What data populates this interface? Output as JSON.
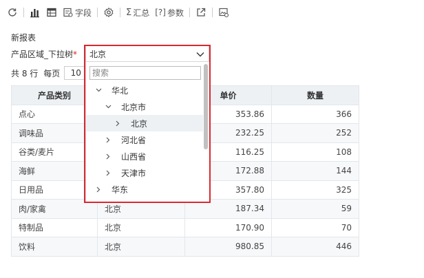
{
  "toolbar": {
    "items": [
      {
        "icon": "refresh-icon"
      },
      {
        "icon": "chart-icon"
      },
      {
        "icon": "table-icon"
      },
      {
        "icon": "field-icon",
        "label": "字段"
      },
      {
        "icon": "settings-icon"
      },
      {
        "icon": "sum-icon",
        "label": "汇总"
      },
      {
        "icon": "param-icon",
        "label": "参数"
      },
      {
        "icon": "export-icon"
      },
      {
        "icon": "image-settings-icon"
      }
    ],
    "param_prefix": "[?]"
  },
  "report": {
    "title": "新报表"
  },
  "param": {
    "label": "产品区域_下拉树",
    "required_mark": "*",
    "value": "北京"
  },
  "pager": {
    "total": "共 8 行",
    "per_page_label": "每页",
    "page_size": "10"
  },
  "dropdown": {
    "search_placeholder": "搜索",
    "nodes": [
      {
        "label": "华北",
        "expanded": true,
        "level": 0
      },
      {
        "label": "北京市",
        "expanded": true,
        "level": 1
      },
      {
        "label": "北京",
        "expanded": false,
        "level": 2,
        "selected": true
      },
      {
        "label": "河北省",
        "expanded": false,
        "level": 1
      },
      {
        "label": "山西省",
        "expanded": false,
        "level": 1
      },
      {
        "label": "天津市",
        "expanded": false,
        "level": 1
      },
      {
        "label": "华东",
        "expanded": false,
        "level": 0
      }
    ]
  },
  "table": {
    "headers": [
      "产品类别",
      "",
      "单价",
      "数量"
    ],
    "rows": [
      [
        "点心",
        "",
        "353.86",
        "366"
      ],
      [
        "调味品",
        "",
        "232.25",
        "252"
      ],
      [
        "谷类/麦片",
        "",
        "116.25",
        "108"
      ],
      [
        "海鲜",
        "",
        "172.88",
        "144"
      ],
      [
        "日用品",
        "",
        "357.80",
        "325"
      ],
      [
        "肉/家禽",
        "北京",
        "187.34",
        "59"
      ],
      [
        "特制品",
        "北京",
        "170.90",
        "70"
      ],
      [
        "饮料",
        "北京",
        "980.85",
        "446"
      ]
    ]
  },
  "colors": {
    "highlight": "#d9282f",
    "header_bg": "#eef1f4"
  }
}
